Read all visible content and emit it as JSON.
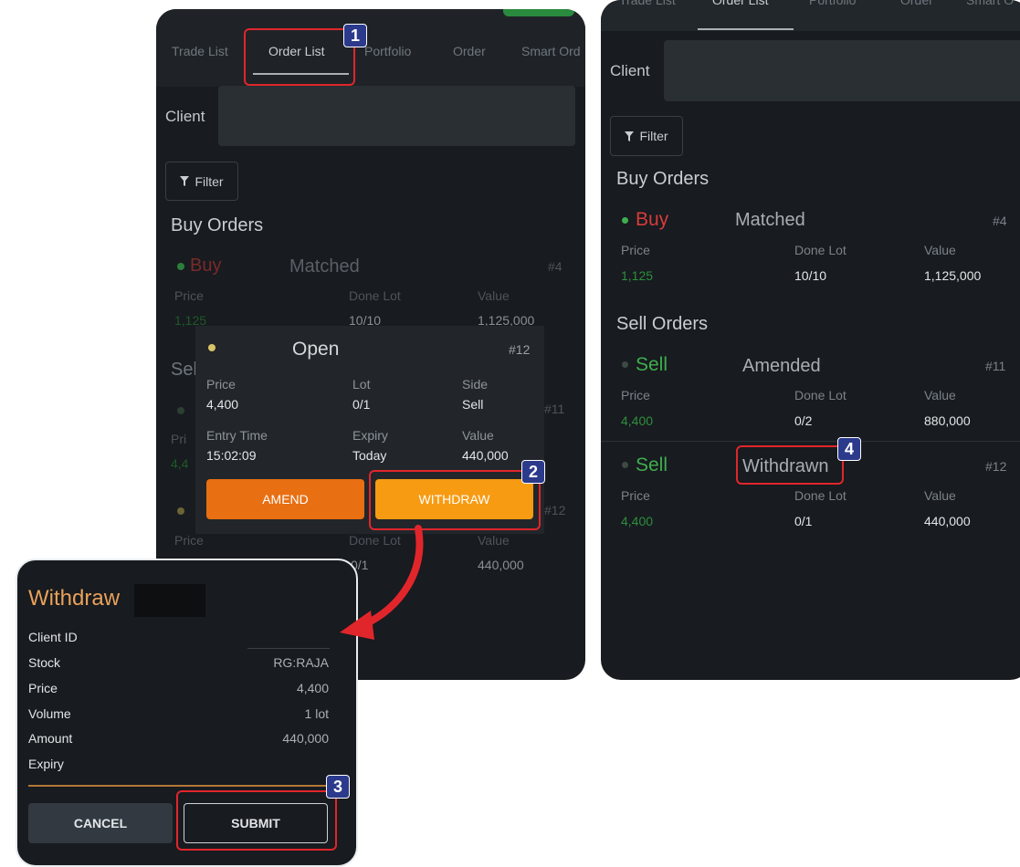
{
  "phone1": {
    "tabs": [
      "Trade List",
      "Order List",
      "Portfolio",
      "Order",
      "Smart Ord"
    ],
    "client_label": "Client",
    "filter_label": "Filter",
    "buy_orders_title": "Buy Orders",
    "sell_orders_title_partial": "Sel",
    "buy_order": {
      "side": "Buy",
      "status": "Matched",
      "number": "#4",
      "price_label": "Price",
      "price": "1,125",
      "done_lot_label": "Done Lot",
      "done_lot": "10/10",
      "value_label": "Value",
      "value": "1,125,000"
    },
    "bg_rows": {
      "number_11": "#11",
      "number_12": "#12",
      "price_label": "Price",
      "done_lot_label": "Done Lot",
      "value_label": "Value",
      "value": "440,000",
      "price_partial": "4,4",
      "pri_partial": "Pri",
      "done_lot_partial": "0/1"
    }
  },
  "popup": {
    "status": "Open",
    "number": "#12",
    "price_label": "Price",
    "price": "4,400",
    "lot_label": "Lot",
    "lot": "0/1",
    "side_label": "Side",
    "side": "Sell",
    "entry_time_label": "Entry Time",
    "entry_time": "15:02:09",
    "expiry_label": "Expiry",
    "expiry": "Today",
    "value_label": "Value",
    "value": "440,000",
    "amend_label": "AMEND",
    "withdraw_label": "WITHDRAW"
  },
  "dialog": {
    "title": "Withdraw",
    "client_id_label": "Client ID",
    "stock_label": "Stock",
    "stock": "RG:RAJA",
    "price_label": "Price",
    "price": "4,400",
    "volume_label": "Volume",
    "volume": "1 lot",
    "amount_label": "Amount",
    "amount": "440,000",
    "expiry_label": "Expiry",
    "cancel_label": "CANCEL",
    "submit_label": "SUBMIT"
  },
  "phone2": {
    "tabs": [
      "Trade List",
      "Order List",
      "Portfolio",
      "Order",
      "Smart O"
    ],
    "client_label": "Client",
    "filter_label": "Filter",
    "buy_orders_title": "Buy Orders",
    "sell_orders_title": "Sell Orders",
    "buy_order": {
      "side": "Buy",
      "status": "Matched",
      "number": "#4",
      "price_label": "Price",
      "price": "1,125",
      "done_lot_label": "Done Lot",
      "done_lot": "10/10",
      "value_label": "Value",
      "value": "1,125,000"
    },
    "sell_order_1": {
      "side": "Sell",
      "status": "Amended",
      "number": "#11",
      "price_label": "Price",
      "price": "4,400",
      "done_lot_label": "Done Lot",
      "done_lot": "0/2",
      "value_label": "Value",
      "value": "880,000"
    },
    "sell_order_2": {
      "side": "Sell",
      "status": "Withdrawn",
      "number": "#12",
      "price_label": "Price",
      "price": "4,400",
      "done_lot_label": "Done Lot",
      "done_lot": "0/1",
      "value_label": "Value",
      "value": "440,000"
    }
  },
  "badges": [
    "1",
    "2",
    "3",
    "4"
  ],
  "colors": {
    "buy": "#d63b3b",
    "sell": "#3fae4f",
    "amend": "#e86f12",
    "withdraw": "#f79b13",
    "dialog_title": "#e9a15b",
    "callout": "#e0262b",
    "badge": "#2c3a8c"
  }
}
